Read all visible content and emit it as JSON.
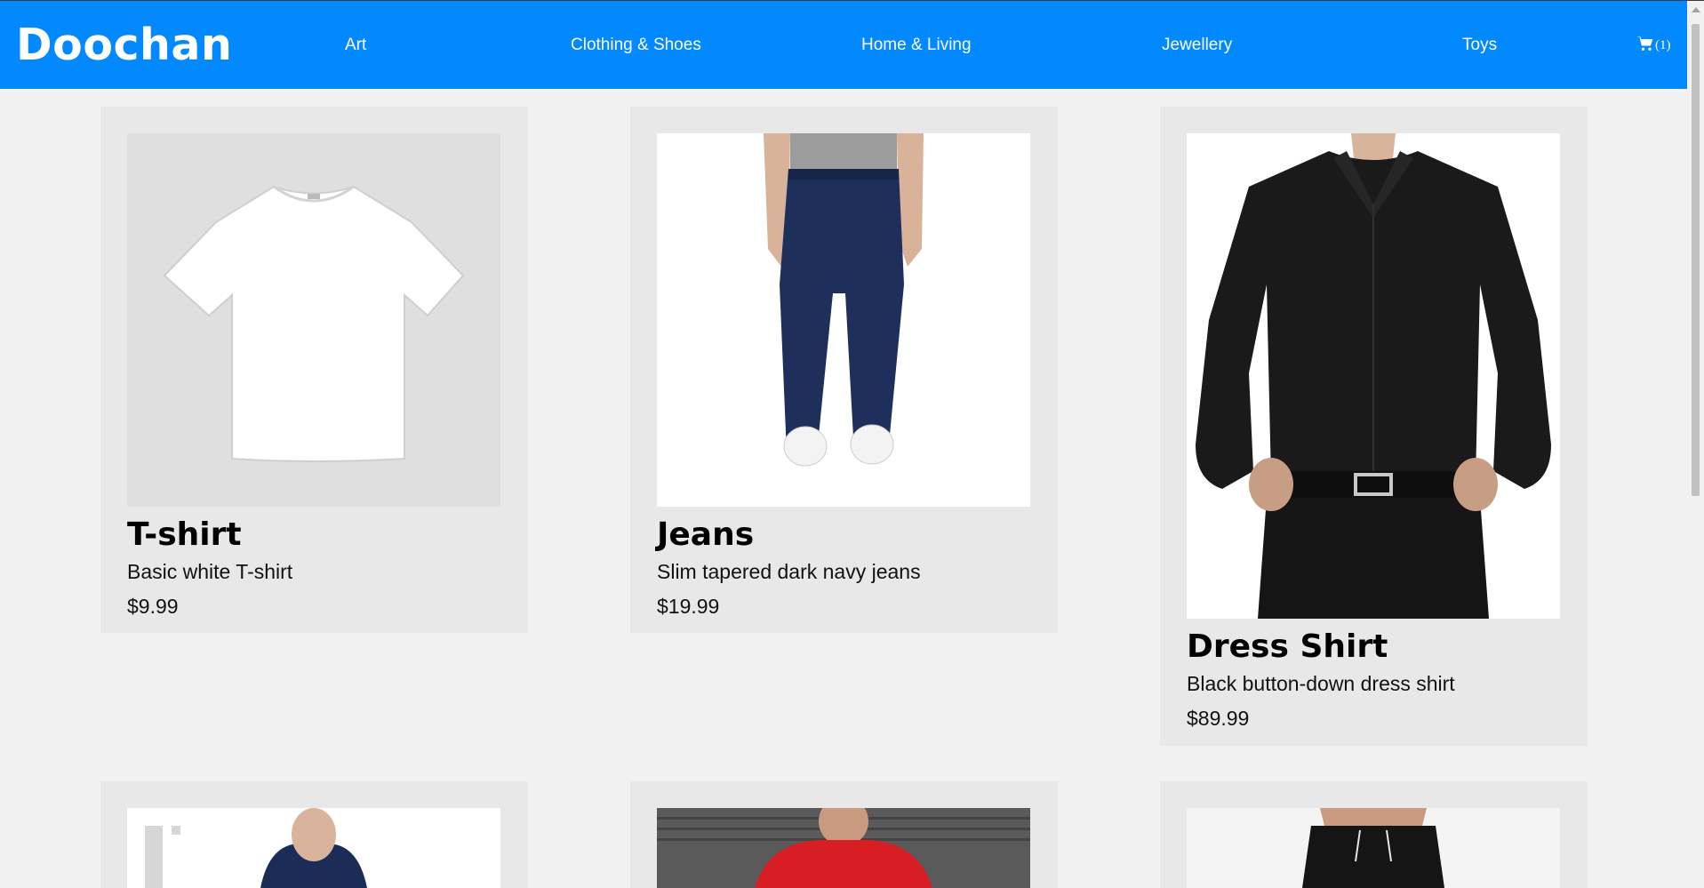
{
  "brand": {
    "name": "Doochan",
    "accent": "#0288ff"
  },
  "nav": {
    "items": [
      {
        "label": "Art"
      },
      {
        "label": "Clothing & Shoes"
      },
      {
        "label": "Home & Living"
      },
      {
        "label": "Jewellery"
      },
      {
        "label": "Toys"
      }
    ],
    "cart": {
      "icon": "cart-icon",
      "count_label": "(1)"
    }
  },
  "products": [
    {
      "title": "T-shirt",
      "description": "Basic white T-shirt",
      "price": "$9.99",
      "image": "white-tshirt"
    },
    {
      "title": "Jeans",
      "description": "Slim tapered dark navy jeans",
      "price": "$19.99",
      "image": "navy-jeans"
    },
    {
      "title": "Dress Shirt",
      "description": "Black button-down dress shirt",
      "price": "$89.99",
      "image": "black-dress-shirt"
    },
    {
      "title": "",
      "description": "",
      "price": "",
      "image": "navy-polo"
    },
    {
      "title": "",
      "description": "",
      "price": "",
      "image": "red-tshirt"
    },
    {
      "title": "",
      "description": "",
      "price": "",
      "image": "black-shorts"
    }
  ]
}
